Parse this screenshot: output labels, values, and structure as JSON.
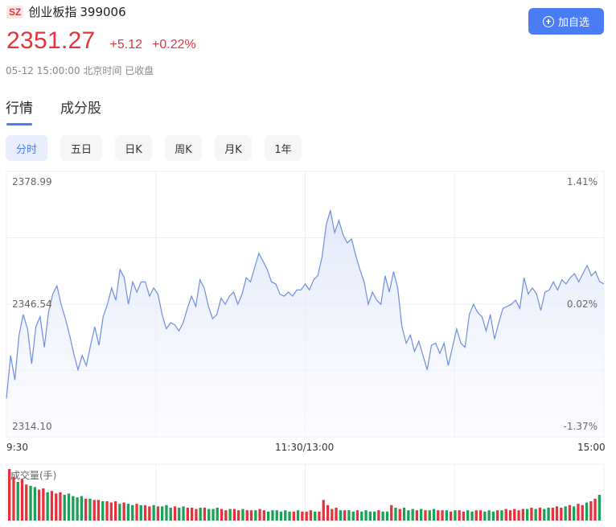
{
  "header": {
    "market": "SZ",
    "name": "创业板指",
    "code": "399006",
    "add_button_label": "加自选"
  },
  "quote": {
    "price": "2351.27",
    "change": "+5.12",
    "change_pct": "+0.22%",
    "time_status": "05-12 15:00:00 北京时间 已收盘"
  },
  "tabs": [
    {
      "label": "行情",
      "active": true
    },
    {
      "label": "成分股",
      "active": false
    }
  ],
  "periods": [
    {
      "label": "分时",
      "active": true
    },
    {
      "label": "五日",
      "active": false
    },
    {
      "label": "日K",
      "active": false
    },
    {
      "label": "周K",
      "active": false
    },
    {
      "label": "月K",
      "active": false
    },
    {
      "label": "1年",
      "active": false
    }
  ],
  "colors": {
    "up": "#e5323b",
    "down": "#1ba05a",
    "line": "#6f8de0",
    "accent": "#4a7cf6"
  },
  "chart_data": {
    "type": "line",
    "y_labels_left": [
      "2378.99",
      "2346.54",
      "2314.10"
    ],
    "y_labels_right": [
      "1.41%",
      "0.02%",
      "-1.37%"
    ],
    "x_labels": [
      "9:30",
      "11:30/13:00",
      "15:00"
    ],
    "ylim": [
      2314.1,
      2378.99
    ],
    "prev_close": 2346.14,
    "volume_title": "成交量(手)",
    "series": [
      {
        "values": [
          2323.5,
          2334.0,
          2328.0,
          2339.0,
          2344.0,
          2340.5,
          2332.0,
          2341.0,
          2343.5,
          2336.0,
          2344.5,
          2349.0,
          2351.0,
          2346.5,
          2343.0,
          2339.0,
          2334.5,
          2330.5,
          2334.0,
          2331.5,
          2336.5,
          2341.0,
          2336.5,
          2343.5,
          2346.5,
          2350.5,
          2347.5,
          2355.0,
          2353.0,
          2346.5,
          2352.0,
          2349.5,
          2352.0,
          2352.0,
          2348.5,
          2350.5,
          2349.0,
          2344.0,
          2340.5,
          2342.0,
          2341.5,
          2340.0,
          2342.0,
          2345.5,
          2348.5,
          2346.0,
          2352.5,
          2350.5,
          2346.0,
          2343.0,
          2344.0,
          2348.0,
          2346.5,
          2348.5,
          2349.5,
          2346.5,
          2349.0,
          2353.0,
          2352.0,
          2355.5,
          2359.0,
          2357.0,
          2355.0,
          2352.0,
          2351.5,
          2349.0,
          2348.5,
          2349.5,
          2348.5,
          2350.0,
          2350.0,
          2351.5,
          2350.0,
          2352.5,
          2353.5,
          2358.0,
          2366.0,
          2369.5,
          2364.0,
          2367.0,
          2363.5,
          2361.5,
          2362.5,
          2358.5,
          2355.0,
          2352.0,
          2346.5,
          2349.5,
          2347.5,
          2346.5,
          2353.5,
          2349.5,
          2354.5,
          2350.5,
          2341.0,
          2337.0,
          2339.0,
          2335.0,
          2337.5,
          2334.0,
          2330.5,
          2336.5,
          2337.0,
          2334.5,
          2337.0,
          2331.5,
          2336.0,
          2340.5,
          2337.0,
          2336.0,
          2344.0,
          2346.5,
          2344.5,
          2343.5,
          2340.0,
          2344.0,
          2338.0,
          2342.0,
          2345.5,
          2346.0,
          2346.5,
          2347.5,
          2345.5,
          2353.0,
          2349.0,
          2350.5,
          2349.0,
          2345.0,
          2349.5,
          2350.0,
          2352.0,
          2350.0,
          2352.5,
          2351.5,
          2353.0,
          2354.0,
          2352.0,
          2354.0,
          2356.0,
          2353.5,
          2354.5,
          2352.0,
          2351.5
        ]
      }
    ],
    "volume": {
      "values": [
        40,
        34,
        30,
        32,
        28,
        27,
        26,
        24,
        25,
        22,
        23,
        21,
        22,
        20,
        21,
        19,
        18,
        19,
        17,
        17,
        16,
        16,
        15,
        15,
        14,
        15,
        13,
        14,
        13,
        12,
        13,
        12,
        12,
        11,
        12,
        11,
        11,
        12,
        10,
        11,
        10,
        11,
        10,
        10,
        9,
        10,
        10,
        9,
        9,
        10,
        9,
        8,
        9,
        9,
        8,
        9,
        8,
        8,
        8,
        9,
        8,
        7,
        8,
        8,
        7,
        8,
        7,
        7,
        8,
        7,
        7,
        8,
        7,
        7,
        16,
        12,
        9,
        10,
        8,
        8,
        8,
        7,
        8,
        7,
        8,
        7,
        7,
        8,
        7,
        7,
        12,
        10,
        9,
        10,
        8,
        9,
        8,
        9,
        8,
        8,
        9,
        8,
        8,
        8,
        7,
        8,
        8,
        7,
        8,
        7,
        8,
        8,
        7,
        8,
        7,
        8,
        8,
        9,
        8,
        9,
        8,
        9,
        9,
        10,
        9,
        10,
        9,
        10,
        10,
        11,
        10,
        11,
        12,
        11,
        13,
        12,
        14,
        15,
        17,
        20
      ],
      "colors": [
        "up",
        "up",
        "down",
        "up",
        "up",
        "down",
        "down",
        "up",
        "up",
        "down",
        "up",
        "up",
        "up",
        "down",
        "down",
        "down",
        "down",
        "down",
        "up",
        "down",
        "up",
        "up",
        "down",
        "up",
        "up",
        "up",
        "down",
        "up",
        "down",
        "down",
        "up",
        "down",
        "up",
        "up",
        "down",
        "up",
        "down",
        "down",
        "down",
        "up",
        "down",
        "down",
        "up",
        "up",
        "up",
        "down",
        "up",
        "down",
        "down",
        "down",
        "up",
        "up",
        "down",
        "up",
        "up",
        "down",
        "up",
        "up",
        "down",
        "up",
        "up",
        "down",
        "down",
        "down",
        "down",
        "down",
        "down",
        "up",
        "down",
        "up",
        "up",
        "up",
        "down",
        "up",
        "up",
        "up",
        "up",
        "up",
        "down",
        "up",
        "down",
        "down",
        "up",
        "down",
        "down",
        "down",
        "down",
        "up",
        "down",
        "down",
        "up",
        "down",
        "up",
        "down",
        "down",
        "down",
        "up",
        "down",
        "up",
        "down",
        "down",
        "up",
        "up",
        "down",
        "up",
        "down",
        "up",
        "up",
        "down",
        "down",
        "up",
        "up",
        "down",
        "down",
        "down",
        "up",
        "down",
        "up",
        "up",
        "up",
        "up",
        "up",
        "down",
        "up",
        "down",
        "up",
        "down",
        "down",
        "up",
        "up",
        "up",
        "down",
        "up",
        "down",
        "up",
        "up",
        "down",
        "up",
        "up",
        "down",
        "up",
        "down",
        "down",
        "up"
      ]
    }
  }
}
